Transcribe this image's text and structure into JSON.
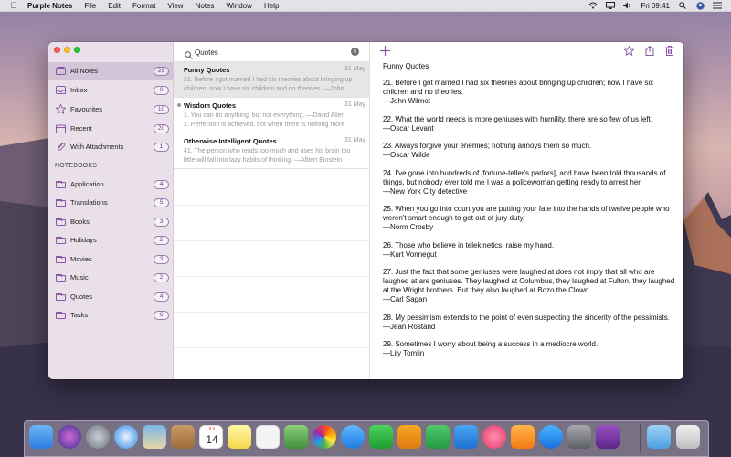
{
  "menubar": {
    "app_name": "Purple Notes",
    "menus": [
      "File",
      "Edit",
      "Format",
      "View",
      "Notes",
      "Window",
      "Help"
    ],
    "clock": "Fri 09:41"
  },
  "sidebar": {
    "items": [
      {
        "label": "All Notes",
        "count": "29",
        "icon": "all-notes-icon"
      },
      {
        "label": "Inbox",
        "count": "0",
        "icon": "inbox-icon"
      },
      {
        "label": "Favourites",
        "count": "10",
        "icon": "star-icon"
      },
      {
        "label": "Recent",
        "count": "20",
        "icon": "calendar-icon"
      },
      {
        "label": "With Attachments",
        "count": "1",
        "icon": "paperclip-icon"
      }
    ],
    "notebooks_header": "NOTEBOOKS",
    "notebooks": [
      {
        "label": "Application",
        "count": "4"
      },
      {
        "label": "Translations",
        "count": "5"
      },
      {
        "label": "Books",
        "count": "3"
      },
      {
        "label": "Holidays",
        "count": "2"
      },
      {
        "label": "Movies",
        "count": "3"
      },
      {
        "label": "Music",
        "count": "2"
      },
      {
        "label": "Quotes",
        "count": "4"
      },
      {
        "label": "Tasks",
        "count": "6"
      }
    ]
  },
  "search": {
    "value": "Quotes"
  },
  "notes": [
    {
      "title": "Funny Quotes",
      "date": "31 May",
      "snippet": "21. Before I got married I had six theories about bringing up children; now I have six children and no theories. —John Wilmot"
    },
    {
      "title": "Wisdom Quotes",
      "date": "31 May",
      "snippet": "1. You can do anything, but not everything. —David Allen\n2. Perfection is achieved, not when there is nothing more"
    },
    {
      "title": "Otherwise Intelligent Quotes",
      "date": "31 May",
      "snippet": "41. The person who reads too much and uses his brain too little will fall into lazy habits of thinking. —Albert Einstein"
    }
  ],
  "editor": {
    "title": "Funny Quotes",
    "quotes": [
      {
        "text": "21. Before I got married I had six theories about bringing up children; now I have six children and no theories.",
        "author": "—John Wilmot"
      },
      {
        "text": "22. What the world needs is more geniuses with humility, there are so few of us left.",
        "author": "—Oscar Levant"
      },
      {
        "text": "23. Always forgive your enemies; nothing annoys them so much.",
        "author": "—Oscar Wilde"
      },
      {
        "text": "24. I've gone into hundreds of [fortune-teller's parlors], and have been told thousands of things, but nobody ever told me I was a policewoman getting ready to arrest her.",
        "author": "—New York City detective"
      },
      {
        "text": "25. When you go into court you are putting your fate into the hands of twelve people who weren't smart enough to get out of jury duty.",
        "author": "—Norm Crosby"
      },
      {
        "text": "26. Those who believe in telekinetics, raise my hand.",
        "author": "—Kurt Vonnegut"
      },
      {
        "text": "27. Just the fact that some geniuses were laughed at does not imply that all who are laughed at are geniuses. They laughed at Columbus, they laughed at Fulton, they laughed at the Wright brothers. But they also laughed at Bozo the Clown.",
        "author": "—Carl Sagan"
      },
      {
        "text": "28. My pessimism extends to the point of even suspecting the sincerity of the pessimists.",
        "author": "—Jean Rostand"
      },
      {
        "text": "29. Sometimes I worry about being a success in a mediocre world.",
        "author": "—Lily Tomlin"
      }
    ]
  },
  "calendar_dock": {
    "month": "JUL",
    "day": "14"
  },
  "colors": {
    "accent": "#8a57a6",
    "selection": "#d4c4d8"
  }
}
